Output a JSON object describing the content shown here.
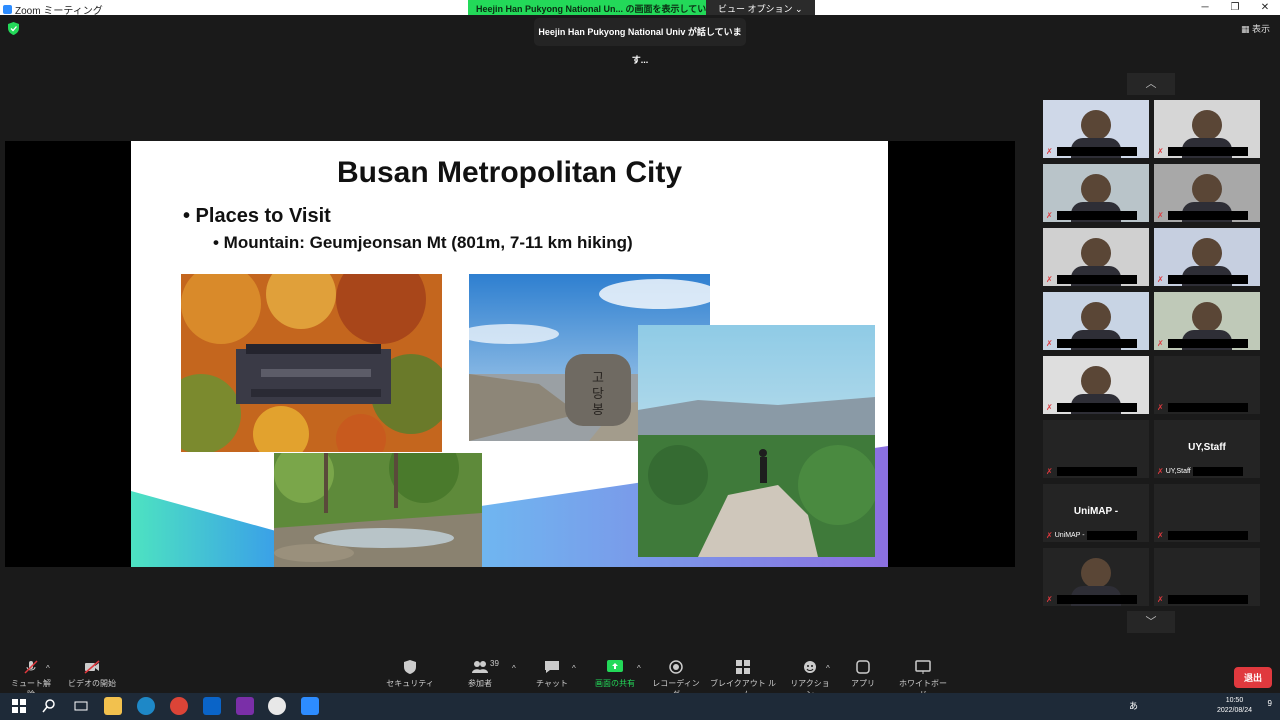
{
  "window": {
    "app_title": "Zoom ミーティング",
    "share_banner": "Heejin Han Pukyong National Un... の画面を表示しています",
    "view_options": "ビュー オプション ⌄",
    "speaking_tip": "Heejin Han Pukyong National Univ が話しています...",
    "view_toggle": "▦ 表示"
  },
  "slide": {
    "title": "Busan Metropolitan City",
    "bullet1": "• Places to Visit",
    "bullet2": "• Mountain: Geumjeonsan Mt (801m, 7-11 km hiking)"
  },
  "participants": [
    {
      "name": "",
      "type": "video"
    },
    {
      "name": "",
      "type": "video"
    },
    {
      "name": "",
      "type": "video"
    },
    {
      "name": "",
      "type": "video"
    },
    {
      "name": "",
      "type": "video"
    },
    {
      "name": "",
      "type": "video"
    },
    {
      "name": "",
      "type": "video"
    },
    {
      "name": "",
      "type": "video"
    },
    {
      "name": "",
      "type": "video"
    },
    {
      "name": "",
      "type": "name"
    },
    {
      "name": "",
      "type": "name"
    },
    {
      "big": "UY,Staff",
      "name": "UY,Staff",
      "type": "name"
    },
    {
      "big": "UniMAP -",
      "name": "UniMAP -",
      "type": "name"
    },
    {
      "name": "",
      "type": "name"
    },
    {
      "name": "",
      "type": "video"
    },
    {
      "name": "",
      "type": "name"
    }
  ],
  "toolbar": {
    "unmute": "ミュート解除",
    "start_video": "ビデオの開始",
    "security": "セキュリティ",
    "participants": "参加者",
    "participant_count": "39",
    "chat": "チャット",
    "share_screen": "画面の共有",
    "recording": "レコーディング",
    "breakout": "ブレイクアウト ルーム",
    "reactions": "リアクション",
    "apps": "アプリ",
    "whiteboard": "ホワイトボード",
    "leave": "退出"
  },
  "taskbar": {
    "time": "10:50",
    "date": "2022/08/24",
    "ime": "あ",
    "notification_count": "9"
  },
  "colors": {
    "share_green": "#23d959",
    "leave_red": "#e0393e",
    "mute_red": "#e0393e",
    "taskbar": "#1e2a38"
  }
}
